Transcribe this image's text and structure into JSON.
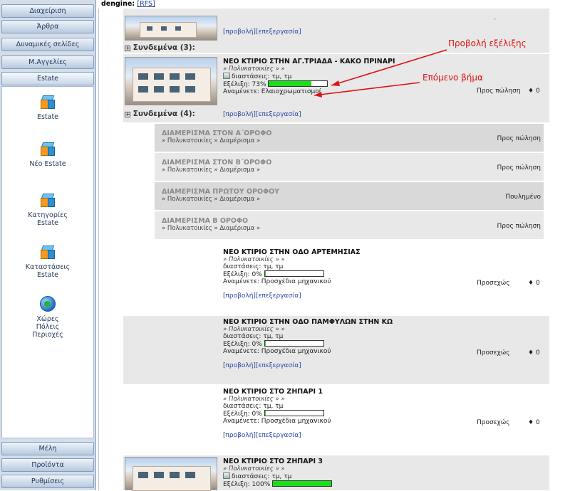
{
  "sidebar": {
    "top_buttons": [
      "Διαχείριση",
      "Άρθρα",
      "Δυναμικές σελίδες",
      "Μ.Αγγελίες",
      "Estate"
    ],
    "tools": [
      "Estate",
      "Νέο Estate",
      "Κατηγορίες Estate",
      "Καταστάσεις Estate",
      "Χώρες Πόλεις Περιοχές"
    ],
    "tool_icons": [
      "cube-icon",
      "cube-icon",
      "cube-icon",
      "cube-icon",
      "globe-icon"
    ],
    "bottom_buttons": [
      "Μέλη",
      "Προϊόντα",
      "Ρυθμίσεις"
    ]
  },
  "topbar": {
    "label": "dengine:",
    "link": "[RFS]"
  },
  "links": {
    "view": "[προβολή]",
    "edit": "[επεξεργασία]"
  },
  "rows": [
    {
      "related": "Συνδεμένα (3):",
      "dash": "-"
    },
    {
      "title": "ΝΕΟ ΚΤΙΡΙΟ ΣΤΗΝ ΑΓ.ΤΡΙΑΔΑ - ΚΑΚΟ ΠΡΙΝΑΡΙ",
      "path": "» Πολυκατοικίες » »",
      "dims": "διαστάσεις: τμ, τμ",
      "progress_label": "Εξέλιξη: 73%",
      "progress": 73,
      "expect": "Αναμένετε: Ελαιοχρωματισμοί",
      "status": "Προς πώληση",
      "count": "0",
      "related": "Συνδεμένα (4):"
    },
    {
      "title": "ΝΕΟ ΚΤΙΡΙΟ ΣΤΗΝ ΟΔΟ ΑΡΤΕΜΗΣΙΑΣ",
      "path": "» Πολυκατοικίες » »",
      "dims": "διαστάσεις: τμ, τμ",
      "progress_label": "Εξέλιξη: 0%",
      "progress": 0,
      "expect": "Αναμένετε: Προσχέδια μηχανικού",
      "status": "Προσεχώς",
      "count": "0"
    },
    {
      "title": "ΝΕΟ ΚΤΙΡΙΟ ΣΤΗΝ ΟΔΟ ΠΑΜΦΥΛΩΝ ΣΤΗΝ ΚΩ",
      "path": "» Πολυκατοικίες » »",
      "dims": "διαστάσεις: τμ, τμ",
      "progress_label": "Εξέλιξη: 0%",
      "progress": 0,
      "expect": "Αναμένετε: Προσχέδια μηχανικού",
      "status": "Προσεχώς",
      "count": "0"
    },
    {
      "title": "ΝΕΟ ΚΤΙΡΙΟ ΣΤΟ ΖΗΠΑΡΙ 1",
      "path": "» Πολυκατοικίες » »",
      "dims": "διαστάσεις: τμ, τμ",
      "progress_label": "Εξέλιξη: 0%",
      "progress": 0,
      "expect": "Αναμένετε: Προσχέδια μηχανικού",
      "status": "Προσεχώς",
      "count": "0"
    },
    {
      "title": "ΝΕΟ ΚΤΙΡΙΟ ΣΤΟ ΖΗΠΑΡΙ 3",
      "path": "» Πολυκατοικίες » »",
      "dims": "διαστάσεις: τμ, τμ",
      "progress_label": "Εξέλιξη: 100%",
      "progress": 100
    }
  ],
  "subitems": [
    {
      "title": "ΔΙΑΜΕΡΙΣΜΑ ΣΤΟΝ Α΄ΟΡΟΦΟ",
      "path": "» Πολυκατοικίες » Διαμέρισμα »",
      "status": "Προς πώληση"
    },
    {
      "title": "ΔΙΑΜΕΡΙΣΜΑ ΣΤΟΝ Β΄ΟΡΟΦΟ",
      "path": "» Πολυκατοικίες » Διαμέρισμα »",
      "status": "Προς πώληση"
    },
    {
      "title": "ΔΙΑΜΕΡΙΣΜΑ ΠΡΩΤΟΥ ΟΡΟΦΟΥ",
      "path": "» Πολυκατοικίες » Διαμέρισμα »",
      "status": "Πουλημένο"
    },
    {
      "title": "ΔΙΑΜΕΡΙΣΜΑ Β ΟΡΟΦΟ",
      "path": "» Πολυκατοικίες » Διαμέρισμα »",
      "status": "Προς πώληση"
    }
  ],
  "annotations": {
    "progress_view": "Προβολή εξέλιξης",
    "next_step": "Επόμενο βήμα",
    "color": "#e01010"
  },
  "colors": {
    "progress_fill": "#18e018",
    "link": "#2347a6",
    "sidebar_bg": "#d5dde8"
  }
}
